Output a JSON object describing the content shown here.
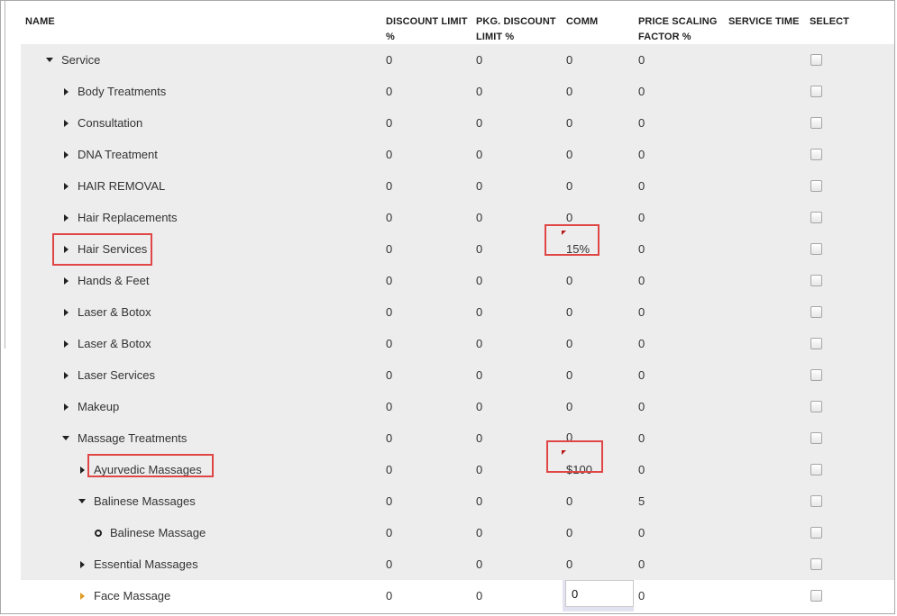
{
  "columns": {
    "name": "NAME",
    "discount_limit": [
      "DISCOUNT LIMIT",
      "%"
    ],
    "pkg_discount_limit": [
      "PKG. DISCOUNT",
      "LIMIT %"
    ],
    "comm": "COMM",
    "price_scaling": [
      "PRICE SCALING",
      "FACTOR %"
    ],
    "service_time": "SERVICE TIME",
    "select": "SELECT"
  },
  "rows": [
    {
      "name": "Service",
      "level": 0,
      "toggle": "expanded",
      "discount": "0",
      "pkg": "0",
      "comm": "0",
      "price": "0"
    },
    {
      "name": "Body Treatments",
      "level": 1,
      "toggle": "collapsed",
      "discount": "0",
      "pkg": "0",
      "comm": "0",
      "price": "0"
    },
    {
      "name": "Consultation",
      "level": 1,
      "toggle": "collapsed",
      "discount": "0",
      "pkg": "0",
      "comm": "0",
      "price": "0"
    },
    {
      "name": "DNA Treatment",
      "level": 1,
      "toggle": "collapsed",
      "discount": "0",
      "pkg": "0",
      "comm": "0",
      "price": "0"
    },
    {
      "name": "HAIR REMOVAL",
      "level": 1,
      "toggle": "collapsed",
      "discount": "0",
      "pkg": "0",
      "comm": "0",
      "price": "0"
    },
    {
      "name": "Hair Replacements",
      "level": 1,
      "toggle": "collapsed",
      "discount": "0",
      "pkg": "0",
      "comm": "0",
      "price": "0"
    },
    {
      "name": "Hair Services",
      "level": 1,
      "toggle": "collapsed",
      "discount": "0",
      "pkg": "0",
      "comm": "15%",
      "price": "0",
      "highlight": true
    },
    {
      "name": "Hands & Feet",
      "level": 1,
      "toggle": "collapsed",
      "discount": "0",
      "pkg": "0",
      "comm": "0",
      "price": "0"
    },
    {
      "name": "Laser & Botox",
      "level": 1,
      "toggle": "collapsed",
      "discount": "0",
      "pkg": "0",
      "comm": "0",
      "price": "0"
    },
    {
      "name": "Laser & Botox",
      "level": 1,
      "toggle": "collapsed",
      "discount": "0",
      "pkg": "0",
      "comm": "0",
      "price": "0"
    },
    {
      "name": "Laser Services",
      "level": 1,
      "toggle": "collapsed",
      "discount": "0",
      "pkg": "0",
      "comm": "0",
      "price": "0"
    },
    {
      "name": "Makeup",
      "level": 1,
      "toggle": "collapsed",
      "discount": "0",
      "pkg": "0",
      "comm": "0",
      "price": "0"
    },
    {
      "name": "Massage Treatments",
      "level": 1,
      "toggle": "expanded",
      "discount": "0",
      "pkg": "0",
      "comm": "0",
      "price": "0"
    },
    {
      "name": "Ayurvedic Massages",
      "level": 2,
      "toggle": "collapsed",
      "discount": "0",
      "pkg": "0",
      "comm": "$100",
      "price": "0",
      "highlight": true
    },
    {
      "name": "Balinese Massages",
      "level": 2,
      "toggle": "expanded",
      "discount": "0",
      "pkg": "0",
      "comm": "0",
      "price": "5"
    },
    {
      "name": "Balinese Massage",
      "level": 3,
      "toggle": "leaf",
      "discount": "0",
      "pkg": "0",
      "comm": "0",
      "price": "0"
    },
    {
      "name": "Essential Massages",
      "level": 2,
      "toggle": "collapsed",
      "discount": "0",
      "pkg": "0",
      "comm": "0",
      "price": "0"
    },
    {
      "name": "Face Massage",
      "level": 2,
      "toggle": "collapsed-orange",
      "discount": "0",
      "pkg": "0",
      "comm": "0",
      "price": "0",
      "editing": true
    }
  ],
  "colors": {
    "highlight": "#e04646",
    "row_bg": "#ededed",
    "marker": "#b41414",
    "orange_arrow": "#e09a22"
  }
}
